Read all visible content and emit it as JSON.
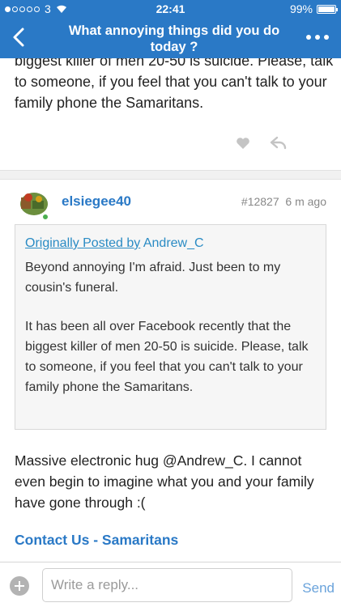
{
  "status_bar": {
    "carrier": "3",
    "time": "22:41",
    "battery": "99%",
    "signal_bars_filled": 1,
    "signal_bars_total": 5
  },
  "navbar": {
    "title": "What annoying things did you do today ?"
  },
  "previous_post": {
    "text_tail": "biggest killer of men 20-50 is suicide. Please, talk to someone, if you feel that you can't talk to your family phone the Samaritans."
  },
  "post": {
    "username": "elsiegee40",
    "post_number": "#12827",
    "time_ago": "6 m ago",
    "quote": {
      "prefix": "Originally Posted by",
      "author": "Andrew_C",
      "paragraph1": "Beyond annoying I'm afraid.  Just been to my cousin's funeral.",
      "paragraph2": "It has been all over Facebook recently that the biggest killer of men 20-50 is suicide. Please, talk to someone, if you feel that you can't talk to your family phone the Samaritans."
    },
    "body": "Massive electronic hug  @Andrew_C. I cannot even begin to imagine what you and your family have gone through :(",
    "link_text": "Contact Us - Samaritans"
  },
  "reply_bar": {
    "placeholder": "Write a reply...",
    "send_label": "Send"
  },
  "colors": {
    "brand": "#2a79c6",
    "link": "#2a8bc4",
    "online": "#4caf50"
  }
}
